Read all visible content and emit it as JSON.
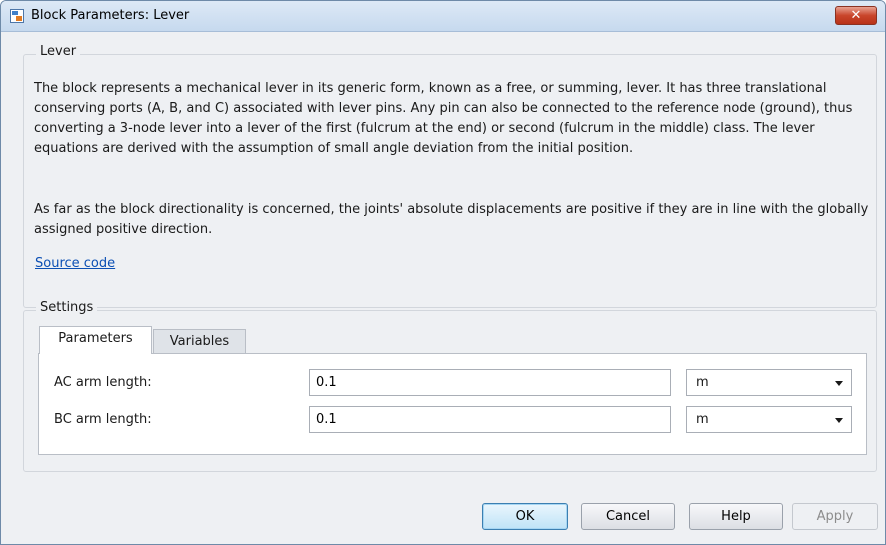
{
  "window": {
    "title": "Block Parameters: Lever",
    "close_label": "✕"
  },
  "lever_group": {
    "label": "Lever",
    "description_1": "The block represents a mechanical lever in its generic form, known as a free, or summing, lever. It has three translational conserving ports (A, B, and C) associated with lever pins. Any pin can also be connected to the reference node (ground), thus converting a 3-node lever into a lever of the first (fulcrum at the end) or second (fulcrum in the middle) class. The lever equations are derived with the assumption of small angle deviation from the initial position.",
    "description_2": "As far as the block directionality is concerned, the joints' absolute displacements are positive if they are in line with the globally assigned positive direction.",
    "source_link": "Source code"
  },
  "settings_group": {
    "label": "Settings",
    "tabs": [
      {
        "label": "Parameters",
        "active": true
      },
      {
        "label": "Variables",
        "active": false
      }
    ],
    "parameters": [
      {
        "label": "AC arm length:",
        "value": "0.1",
        "unit": "m"
      },
      {
        "label": "BC arm length:",
        "value": "0.1",
        "unit": "m"
      }
    ]
  },
  "buttons": {
    "ok": "OK",
    "cancel": "Cancel",
    "help": "Help",
    "apply": "Apply"
  },
  "colors": {
    "link": "#0b4fb4",
    "close_button": "#c9452b",
    "default_button_border": "#3c7fb1"
  },
  "icons": {
    "title": "simulink-block-icon",
    "close": "close-icon",
    "dropdown": "chevron-down-icon"
  }
}
